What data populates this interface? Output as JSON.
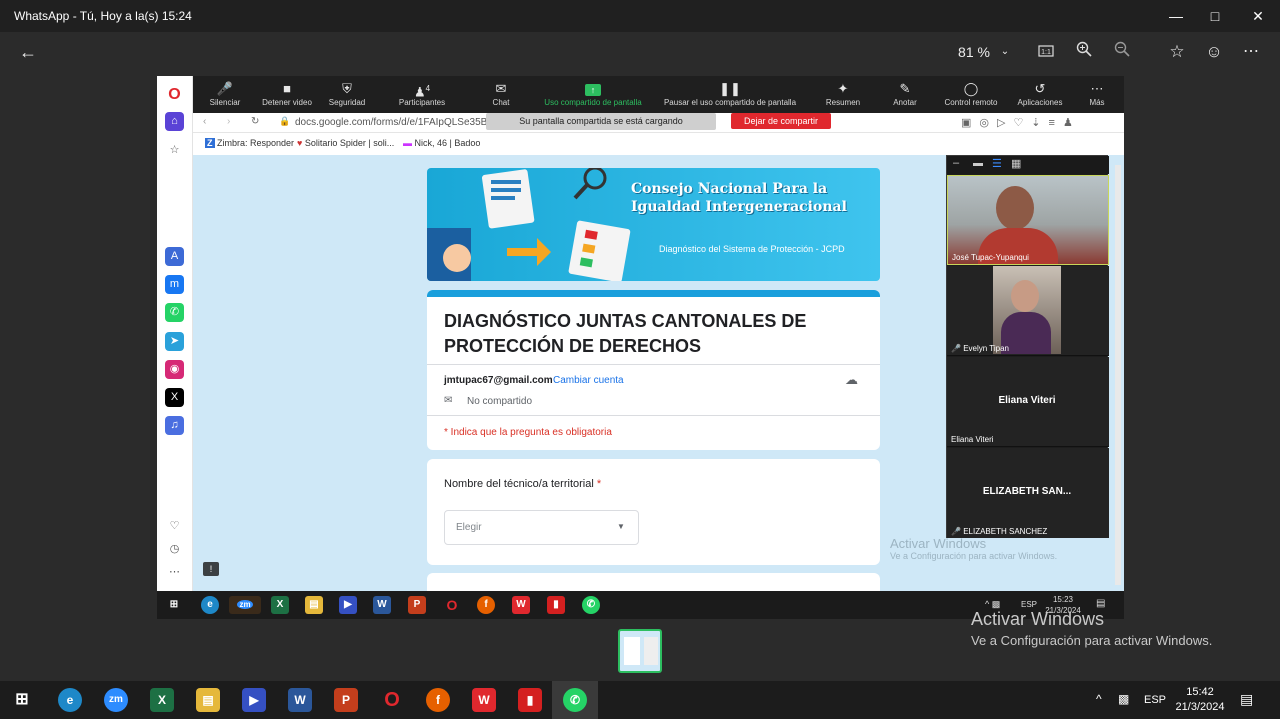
{
  "window": {
    "title": "WhatsApp - Tú, Hoy a la(s) 15:24"
  },
  "viewer": {
    "zoom": "81 %"
  },
  "zoom_toolbar": {
    "items": [
      "Silenciar",
      "Detener video",
      "Seguridad",
      "Participantes",
      "Chat",
      "Uso compartido de pantalla",
      "Pausar el uso compartido de pantalla",
      "Resumen",
      "Anotar",
      "Control remoto",
      "Aplicaciones",
      "Más"
    ],
    "participants_count": "4",
    "loading_text": "Su pantalla compartida se está cargando",
    "stop_share": "Dejar de compartir",
    "accent": "#2dbe60"
  },
  "browser": {
    "url": "docs.google.com/forms/d/e/1FAIpQLSe35BG6",
    "bookmarks": [
      "Zimbra: Responder",
      "Solitario Spider | soli...",
      "Nick, 46 | Badoo"
    ]
  },
  "form": {
    "banner_title": "Consejo Nacional Para la Igualdad Intergeneracional",
    "banner_subtitle": "Diagnóstico del Sistema de Protección - JCPD",
    "title": "DIAGNÓSTICO JUNTAS CANTONALES DE PROTECCIÓN DE DERECHOS",
    "email": "jmtupac67@gmail.com",
    "switch_account": "Cambiar cuenta",
    "not_shared": "No compartido",
    "required_note": "* Indica que la pregunta es obligatoria",
    "question1": "Nombre del técnico/a territorial",
    "required_mark": "*",
    "dropdown_placeholder": "Elegir",
    "header_color": "#1a9fdc"
  },
  "participants": [
    {
      "name": "José Tupac-Yupanqui",
      "label": ""
    },
    {
      "name": "Evelyn Tipan",
      "label": ""
    },
    {
      "name": "Eliana Viteri",
      "label": "Eliana Viteri"
    },
    {
      "name": "ELIZABETH SANCHEZ",
      "label": "ELIZABETH SAN..."
    }
  ],
  "inner_taskbar": {
    "lang": "ESP",
    "time": "15:23",
    "date": "21/3/2024"
  },
  "activate_windows": {
    "title": "Activar Windows",
    "subtitle": "Ve a Configuración para activar Windows."
  },
  "taskbar": {
    "lang": "ESP",
    "time": "15:42",
    "date": "21/3/2024"
  }
}
